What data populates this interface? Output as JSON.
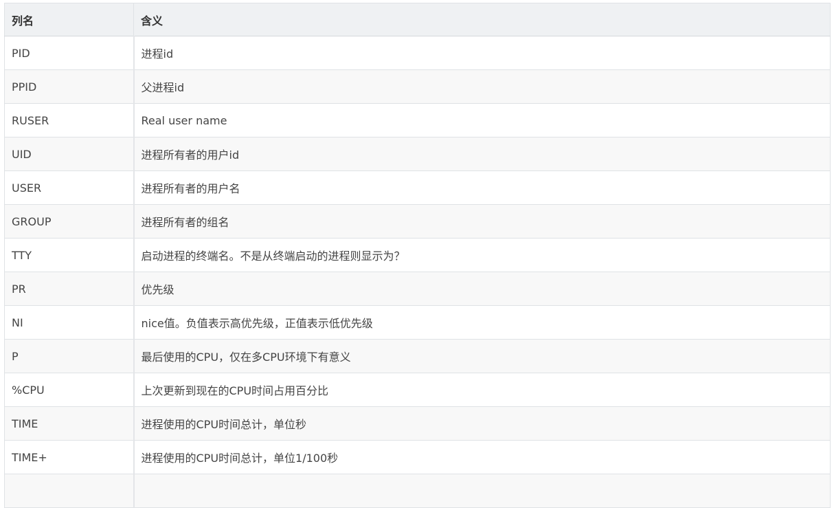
{
  "table": {
    "headers": {
      "name": "列名",
      "meaning": "含义"
    },
    "rows": [
      {
        "name": "PID",
        "meaning": "进程id"
      },
      {
        "name": "PPID",
        "meaning": "父进程id"
      },
      {
        "name": "RUSER",
        "meaning": "Real user name"
      },
      {
        "name": "UID",
        "meaning": "进程所有者的用户id"
      },
      {
        "name": "USER",
        "meaning": "进程所有者的用户名"
      },
      {
        "name": "GROUP",
        "meaning": "进程所有者的组名"
      },
      {
        "name": "TTY",
        "meaning": "启动进程的终端名。不是从终端启动的进程则显示为？"
      },
      {
        "name": "PR",
        "meaning": "优先级"
      },
      {
        "name": "NI",
        "meaning": "nice值。负值表示高优先级，正值表示低优先级"
      },
      {
        "name": "P",
        "meaning": "最后使用的CPU，仅在多CPU环境下有意义"
      },
      {
        "name": "%CPU",
        "meaning": "上次更新到现在的CPU时间占用百分比"
      },
      {
        "name": "TIME",
        "meaning": "进程使用的CPU时间总计，单位秒"
      },
      {
        "name": "TIME+",
        "meaning": "进程使用的CPU时间总计，单位1/100秒"
      },
      {
        "name": "",
        "meaning": ""
      }
    ]
  }
}
